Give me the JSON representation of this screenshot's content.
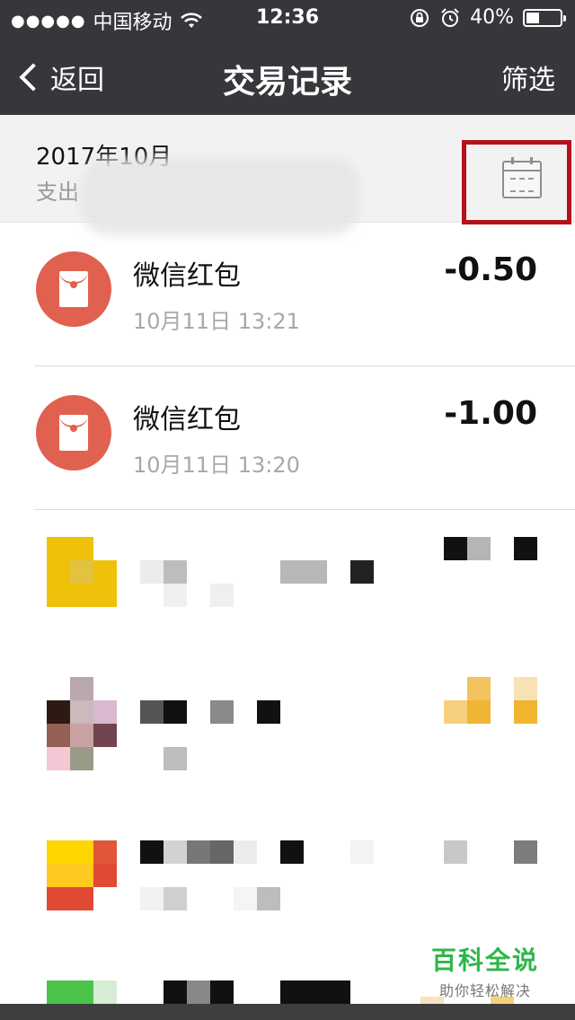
{
  "status_bar": {
    "signal_dots": "●●●●●",
    "carrier": "中国移动",
    "wifi_icon": "wifi-icon",
    "time": "12:36",
    "battery_percent": "40%",
    "battery_level": 0.4
  },
  "nav": {
    "back_label": "返回",
    "title": "交易记录",
    "filter_label": "筛选"
  },
  "month_header": {
    "title": "2017年10月",
    "subtitle": "支出"
  },
  "transactions": [
    {
      "name": "微信红包",
      "time": "10月11日 13:21",
      "amount": "-0.50"
    },
    {
      "name": "微信红包",
      "time": "10月11日 13:20",
      "amount": "-1.00"
    }
  ],
  "colors": {
    "nav_bg": "#37373b",
    "highlight_box": "#b3121a",
    "red_packet": "#e0614f",
    "watermark": "#2fb64a"
  },
  "watermark": {
    "main": "百科全说",
    "sub": "助你轻松解决"
  }
}
